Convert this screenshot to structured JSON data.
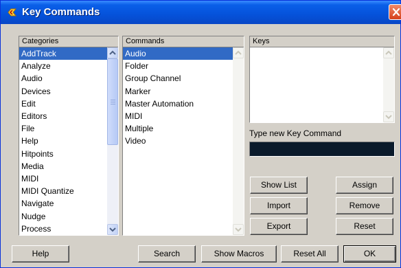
{
  "window": {
    "title": "Key Commands",
    "close_label": "close"
  },
  "categories": {
    "header": "Categories",
    "items": [
      "AddTrack",
      "Analyze",
      "Audio",
      "Devices",
      "Edit",
      "Editors",
      "File",
      "Help",
      "Hitpoints",
      "Media",
      "MIDI",
      "MIDI Quantize",
      "Navigate",
      "Nudge",
      "Process"
    ],
    "selected": "AddTrack"
  },
  "commands": {
    "header": "Commands",
    "items": [
      "Audio",
      "Folder",
      "Group Channel",
      "Marker",
      "Master Automation",
      "MIDI",
      "Multiple",
      "Video"
    ],
    "selected": "Audio"
  },
  "keys": {
    "header": "Keys",
    "items": []
  },
  "new_key": {
    "label": "Type new Key Command",
    "value": ""
  },
  "buttons": {
    "show_list": "Show List",
    "import": "Import",
    "export": "Export",
    "assign": "Assign",
    "remove": "Remove",
    "reset": "Reset",
    "help": "Help",
    "search": "Search",
    "show_macros": "Show Macros",
    "reset_all": "Reset All",
    "ok": "OK"
  },
  "colors": {
    "titlebar": "#0552da",
    "selection": "#316ac5",
    "dialog_bg": "#d4d0c8",
    "key_field": "#0a1a2b"
  },
  "icons": {
    "app": "cubase-logo-icon",
    "close": "close-icon",
    "scroll_up": "chevron-up-icon",
    "scroll_down": "chevron-down-icon"
  }
}
